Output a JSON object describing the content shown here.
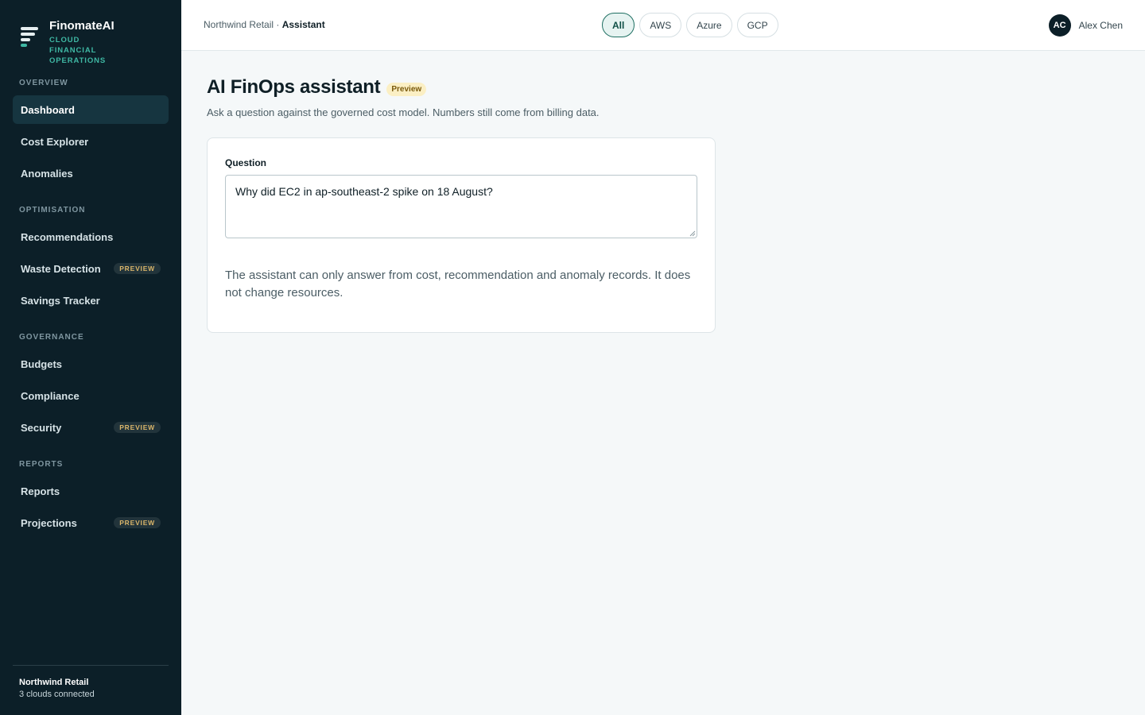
{
  "brand": {
    "name": "FinomateAI",
    "subtitle": "CLOUD FINANCIAL OPERATIONS"
  },
  "sidebar": {
    "sections": [
      {
        "label": "OVERVIEW"
      },
      {
        "label": "OPTIMISATION"
      },
      {
        "label": "GOVERNANCE"
      },
      {
        "label": "REPORTS"
      }
    ],
    "items": [
      {
        "label": "Dashboard",
        "active": true
      },
      {
        "label": "Cost Explorer"
      },
      {
        "label": "Anomalies"
      },
      {
        "label": "Recommendations"
      },
      {
        "label": "Waste Detection",
        "badge": "PREVIEW"
      },
      {
        "label": "Savings Tracker"
      },
      {
        "label": "Budgets"
      },
      {
        "label": "Compliance"
      },
      {
        "label": "Security",
        "badge": "PREVIEW"
      },
      {
        "label": "Reports"
      },
      {
        "label": "Projections",
        "badge": "PREVIEW"
      }
    ],
    "footer": {
      "org": "Northwind Retail",
      "status": "3 clouds connected"
    }
  },
  "header": {
    "breadcrumb": {
      "org": "Northwind Retail",
      "separator": " · ",
      "current": "Assistant"
    },
    "cloud_filter": [
      {
        "label": "All",
        "selected": true
      },
      {
        "label": "AWS"
      },
      {
        "label": "Azure"
      },
      {
        "label": "GCP"
      }
    ],
    "user": {
      "initials": "AC",
      "name": "Alex Chen"
    }
  },
  "main": {
    "title": "AI FinOps assistant",
    "title_badge": "Preview",
    "subtitle": "Ask a question against the governed cost model. Numbers still come from billing data.",
    "card": {
      "field_label": "Question",
      "question_value": "Why did EC2 in ap-southeast-2 spike on 18 August?",
      "note": "The assistant can only answer from cost, recommendation and anomaly records. It does not change resources."
    }
  },
  "colors": {
    "sidebar_bg": "#0c1f28",
    "accent": "#3fb8a4",
    "active_chip": "#1f6f62",
    "badge_bg": "#fbefc4"
  }
}
